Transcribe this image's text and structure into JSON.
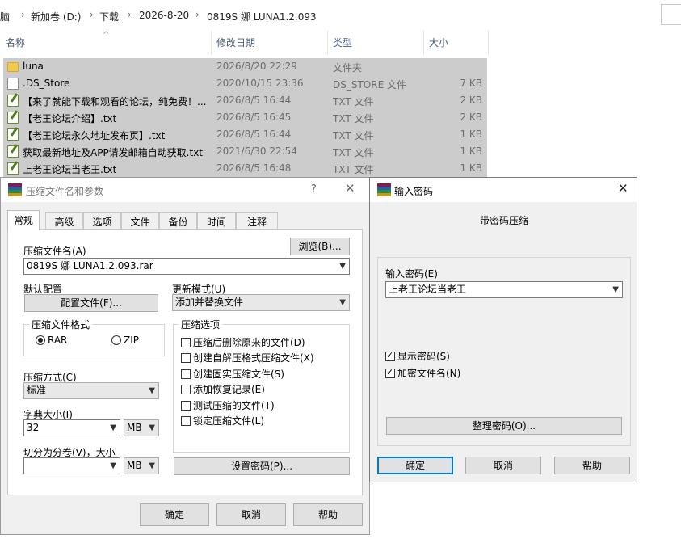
{
  "explorer": {
    "breadcrumb": [
      "脑",
      "新加卷 (D:)",
      "下载",
      "2026-8-20",
      "0819S 娜 LUNA1.2.093"
    ],
    "columns": {
      "name": "名称",
      "modified": "修改日期",
      "type": "类型",
      "size": "大小"
    },
    "sort_indicator": "^",
    "files": [
      {
        "name": "luna",
        "date": "2026/8/20 22:29",
        "type": "文件夹",
        "size": "",
        "icon": "folder-icon"
      },
      {
        "name": ".DS_Store",
        "date": "2020/10/15 23:36",
        "type": "DS_STORE 文件",
        "size": "7 KB",
        "icon": "file-icon"
      },
      {
        "name": "【来了就能下载和观看的论坛，纯免费！...",
        "date": "2026/8/5 16:44",
        "type": "TXT 文件",
        "size": "2 KB",
        "icon": "txt-file-icon"
      },
      {
        "name": "【老王论坛介绍】.txt",
        "date": "2026/8/5 16:45",
        "type": "TXT 文件",
        "size": "2 KB",
        "icon": "txt-file-icon"
      },
      {
        "name": "【老王论坛永久地址发布页】.txt",
        "date": "2026/8/5 16:44",
        "type": "TXT 文件",
        "size": "1 KB",
        "icon": "txt-file-icon"
      },
      {
        "name": "获取最新地址及APP请发邮箱自动获取.txt",
        "date": "2021/6/30 22:54",
        "type": "TXT 文件",
        "size": "1 KB",
        "icon": "txt-file-icon"
      },
      {
        "name": "上老王论坛当老王.txt",
        "date": "2026/8/5 16:48",
        "type": "TXT 文件",
        "size": "1 KB",
        "icon": "txt-file-icon"
      }
    ]
  },
  "archive_dialog": {
    "title": "压缩文件名和参数",
    "help_glyph": "?",
    "close_glyph": "✕",
    "tabs": [
      "常规",
      "高级",
      "选项",
      "文件",
      "备份",
      "时间",
      "注释"
    ],
    "archive_name_label": "压缩文件名(A)",
    "browse_button": "浏览(B)...",
    "archive_name_value": "0819S 娜 LUNA1.2.093.rar",
    "default_profile_label": "默认配置",
    "profiles_button": "配置文件(F)...",
    "update_mode_label": "更新模式(U)",
    "update_mode_value": "添加并替换文件",
    "format_group_label": "压缩文件格式",
    "format_rar": "RAR",
    "format_zip": "ZIP",
    "options_group_label": "压缩选项",
    "options": [
      "压缩后删除原来的文件(D)",
      "创建自解压格式压缩文件(X)",
      "创建固实压缩文件(S)",
      "添加恢复记录(E)",
      "测试压缩的文件(T)",
      "锁定压缩文件(L)"
    ],
    "method_label": "压缩方式(C)",
    "method_value": "标准",
    "dict_label": "字典大小(I)",
    "dict_value": "32",
    "dict_unit": "MB",
    "split_label": "切分为分卷(V)，大小",
    "split_value": "",
    "split_unit": "MB",
    "set_password_button": "设置密码(P)...",
    "ok_button": "确定",
    "cancel_button": "取消",
    "help_button": "帮助"
  },
  "password_dialog": {
    "title": "输入密码",
    "close_glyph": "✕",
    "heading": "带密码压缩",
    "password_label": "输入密码(E)",
    "password_value": "上老王论坛当老王",
    "show_password": "显示密码(S)",
    "encrypt_names": "加密文件名(N)",
    "organize_button": "整理密码(O)...",
    "ok_button": "确定",
    "cancel_button": "取消",
    "help_button": "帮助"
  },
  "colors": {
    "selection_gray": "#cccccc",
    "dialog_bg": "#f0f0f0",
    "focus_blue": "#0078d7",
    "header_text": "#4c607a"
  }
}
